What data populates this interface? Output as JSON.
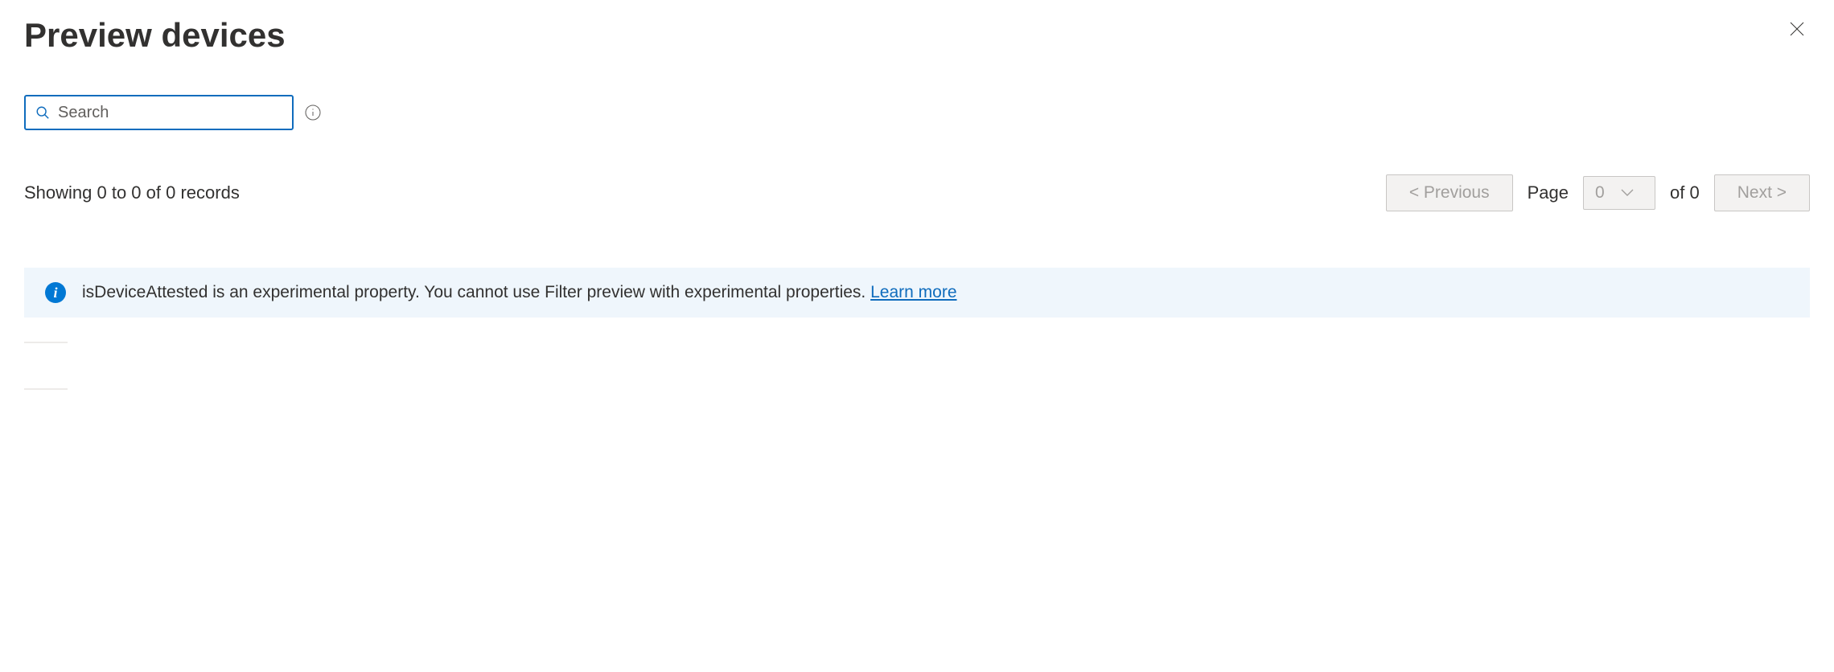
{
  "header": {
    "title": "Preview devices"
  },
  "search": {
    "placeholder": "Search"
  },
  "records": {
    "status": "Showing 0 to 0 of 0 records"
  },
  "pagination": {
    "previous_label": "<  Previous",
    "page_label": "Page",
    "page_value": "0",
    "of_label": "of 0",
    "next_label": "Next  >"
  },
  "callout": {
    "message": "isDeviceAttested is an experimental property. You cannot use Filter preview with experimental properties. ",
    "link_label": "Learn more"
  }
}
